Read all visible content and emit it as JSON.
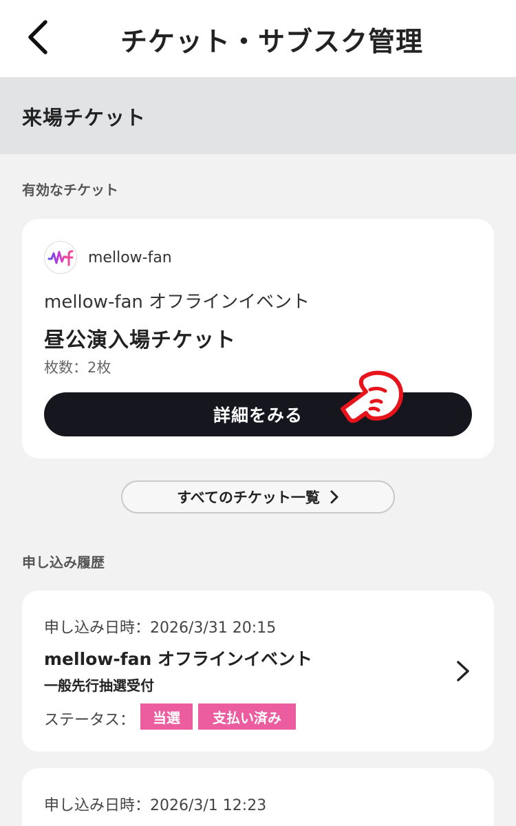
{
  "header": {
    "title": "チケット・サブスク管理"
  },
  "section": {
    "title": "来場チケット"
  },
  "valid_tickets": {
    "heading": "有効なチケット",
    "ticket": {
      "org_name": "mellow-fan",
      "event_name": "mellow-fan オフラインイベント",
      "title": "昼公演入場チケット",
      "count": "枚数：2枚",
      "detail_button": "詳細をみる"
    },
    "all_tickets_button": "すべてのチケット一覧"
  },
  "history": {
    "heading": "申し込み履歴",
    "items": [
      {
        "date": "申し込み日時：2026/3/31 20:15",
        "event": "mellow-fan オフラインイベント",
        "type": "一般先行抽選受付",
        "status_label": "ステータス：",
        "badges": [
          "当選",
          "支払い済み"
        ]
      },
      {
        "date": "申し込み日時：2026/3/1 12:23"
      }
    ]
  },
  "colors": {
    "badge": "#ec5d9f",
    "primary_button": "#16161e",
    "pointer_hand": "#e8141c"
  }
}
